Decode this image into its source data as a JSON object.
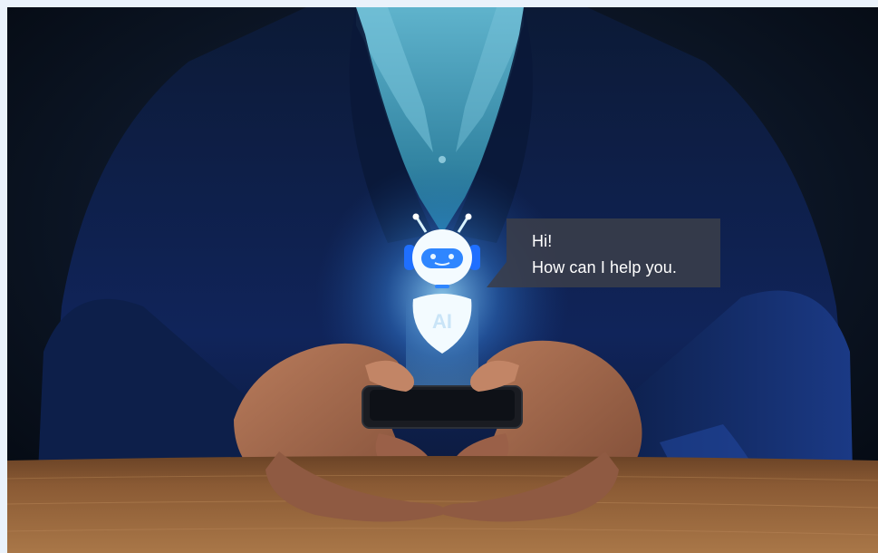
{
  "image": {
    "subject": "person in a dark suit holding a smartphone with a glowing AI chatbot icon",
    "chatbot_badge": "AI",
    "chat_bubble": {
      "line1": "Hi!",
      "line2": "How can I help you."
    }
  },
  "colors": {
    "page_border": "#eaf2fb",
    "background": "#0b1524",
    "suit": "#0f2044",
    "shirt": "#2f8fb0",
    "skin": "#a26a50",
    "table": "#8a5a34",
    "glow": "#79c8ff",
    "bubble": "#3a3e4a",
    "bubble_text": "#ffffff"
  },
  "icons": [
    "robot-head-icon",
    "ai-shield-icon",
    "smartphone"
  ]
}
